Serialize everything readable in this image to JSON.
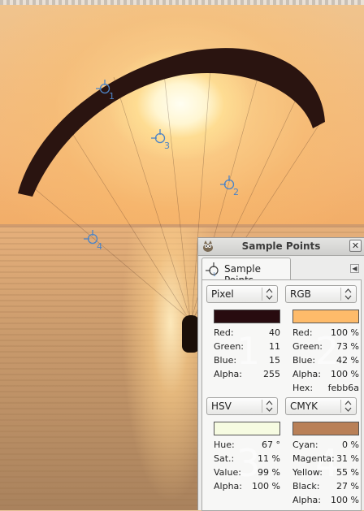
{
  "window": {
    "title": "Sample Points",
    "close_glyph": "✕",
    "tab_label": "Sample Points",
    "tab_menu_glyph": "◀"
  },
  "canvas": {
    "sample_points": [
      {
        "label": "1"
      },
      {
        "label": "2"
      },
      {
        "label": "3"
      },
      {
        "label": "4"
      }
    ],
    "marker_color": "#4d84c6"
  },
  "samples": [
    {
      "number": "1",
      "mode": "Pixel",
      "swatch_color": "#280b0f",
      "rows": [
        {
          "label": "Red:",
          "value": "40"
        },
        {
          "label": "Green:",
          "value": "11"
        },
        {
          "label": "Blue:",
          "value": "15"
        },
        {
          "label": "Alpha:",
          "value": "255"
        }
      ]
    },
    {
      "number": "2",
      "mode": "RGB",
      "swatch_color": "#febb6a",
      "rows": [
        {
          "label": "Red:",
          "value": "100 %"
        },
        {
          "label": "Green:",
          "value": "73 %"
        },
        {
          "label": "Blue:",
          "value": "42 %"
        },
        {
          "label": "Alpha:",
          "value": "100 %"
        },
        {
          "label": "Hex:",
          "value": "febb6a"
        }
      ]
    },
    {
      "number": "3",
      "mode": "HSV",
      "swatch_color": "#f6fbe1",
      "rows": [
        {
          "label": "Hue:",
          "value": "67 °"
        },
        {
          "label": "Sat.:",
          "value": "11 %"
        },
        {
          "label": "Value:",
          "value": "99 %"
        },
        {
          "label": "Alpha:",
          "value": "100 %"
        }
      ]
    },
    {
      "number": "4",
      "mode": "CMYK",
      "swatch_color": "#b98057",
      "rows": [
        {
          "label": "Cyan:",
          "value": "0 %"
        },
        {
          "label": "Magenta:",
          "value": "31 %"
        },
        {
          "label": "Yellow:",
          "value": "55 %"
        },
        {
          "label": "Black:",
          "value": "27 %"
        },
        {
          "label": "Alpha:",
          "value": "100 %"
        }
      ]
    }
  ],
  "icons": {
    "gimp": "gimp-wilber-icon",
    "sample_point": "sample-point-icon",
    "combo_arrow": "updown-arrows-icon"
  }
}
